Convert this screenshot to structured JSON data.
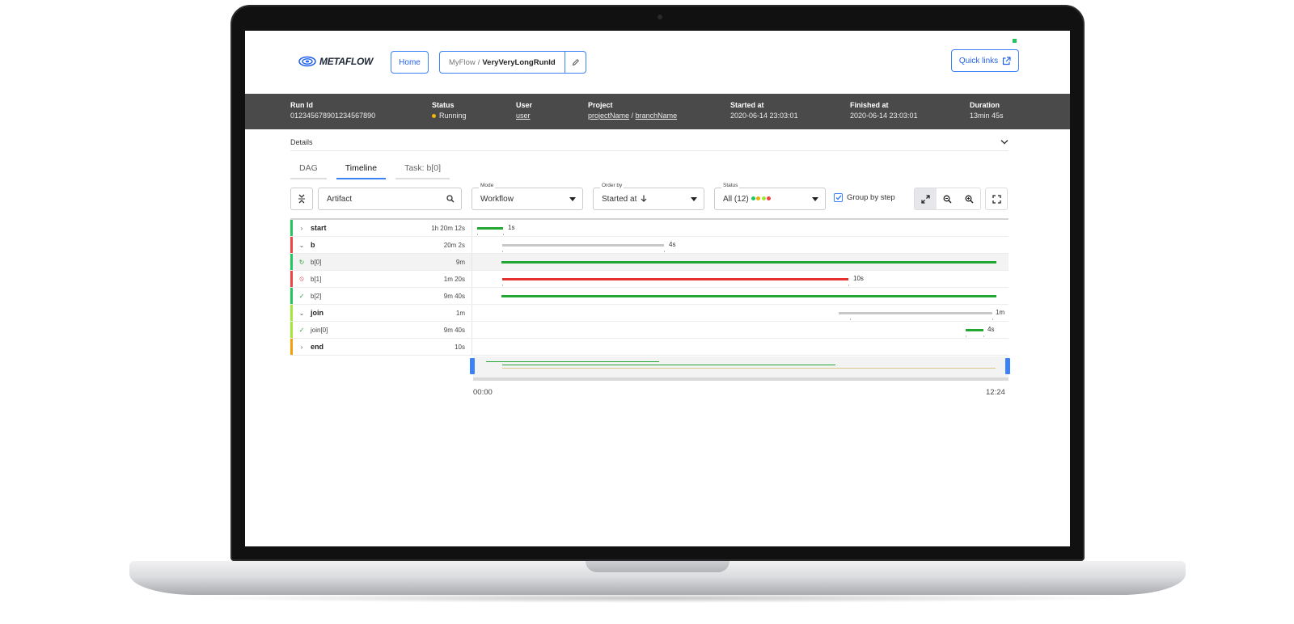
{
  "header": {
    "logo_text": "METAFLOW",
    "home_label": "Home",
    "breadcrumb_flow": "MyFlow",
    "breadcrumb_separator": "/",
    "breadcrumb_run": "VeryVeryLongRunId",
    "quick_links_label": "Quick links"
  },
  "run_info": {
    "run_id": {
      "label": "Run Id",
      "value": "01234567890123456789​0"
    },
    "status": {
      "label": "Status",
      "value": "Running"
    },
    "user": {
      "label": "User",
      "value": "user"
    },
    "project": {
      "label": "Project",
      "project_name": "projectName",
      "separator": "/",
      "branch_name": "branchName"
    },
    "started_at": {
      "label": "Started at",
      "value": "2020-06-14 23:03:01"
    },
    "finished_at": {
      "label": "Finished at",
      "value": "2020-06-14 23:03:01"
    },
    "duration": {
      "label": "Duration",
      "value": "13min 45s"
    }
  },
  "details_label": "Details",
  "tabs": [
    {
      "label": "DAG",
      "active": false
    },
    {
      "label": "Timeline",
      "active": true
    },
    {
      "label": "Task: b[0]",
      "active": false
    }
  ],
  "controls": {
    "search_value": "Artifact",
    "mode": {
      "label": "Mode",
      "value": "Workflow"
    },
    "order_by": {
      "label": "Order by",
      "value": "Started at"
    },
    "status": {
      "label": "Status",
      "value": "All (12)"
    },
    "status_dot_colors": [
      "#22c55e",
      "#eab308",
      "#a3e635",
      "#ef4444"
    ],
    "group_by_label": "Group by step",
    "group_by_checked": true
  },
  "timeline": {
    "rows": [
      {
        "kind": "step",
        "name": "start",
        "duration": "1h 20m 12s",
        "icon": "chevron-right-icon",
        "border": "#22c55e",
        "bar_color": "#22a832",
        "bar_label": "1s"
      },
      {
        "kind": "step",
        "name": "b",
        "duration": "20m 2s",
        "icon": "chevron-down-icon",
        "border": "#ef4444",
        "bar_color": "#c8c8c8",
        "bar_label": "4s"
      },
      {
        "kind": "task",
        "name": "b[0]",
        "duration": "9m",
        "icon": "refresh-icon",
        "border": "#22c55e",
        "bar_color": "#22a832",
        "bar_label": ""
      },
      {
        "kind": "task",
        "name": "b[1]",
        "duration": "1m 20s",
        "icon": "error-icon",
        "border": "#ef4444",
        "bar_color": "#e53030",
        "bar_label": "10s"
      },
      {
        "kind": "task",
        "name": "b[2]",
        "duration": "9m 40s",
        "icon": "check-circle-icon",
        "border": "#22c55e",
        "bar_color": "#22a832",
        "bar_label": ""
      },
      {
        "kind": "step",
        "name": "join",
        "duration": "1m",
        "icon": "chevron-down-icon",
        "border": "#a3e635",
        "bar_color": "#c8c8c8",
        "bar_label": "1m"
      },
      {
        "kind": "task",
        "name": "join[0]",
        "duration": "9m 40s",
        "icon": "check-circle-icon",
        "border": "#a3e635",
        "bar_color": "#22a832",
        "bar_label": "4s"
      },
      {
        "kind": "step",
        "name": "end",
        "duration": "10s",
        "icon": "chevron-right-icon",
        "border": "#f59e0b",
        "bar_color": "",
        "bar_label": ""
      }
    ],
    "time_start": "00:00",
    "time_end": "12:24"
  }
}
